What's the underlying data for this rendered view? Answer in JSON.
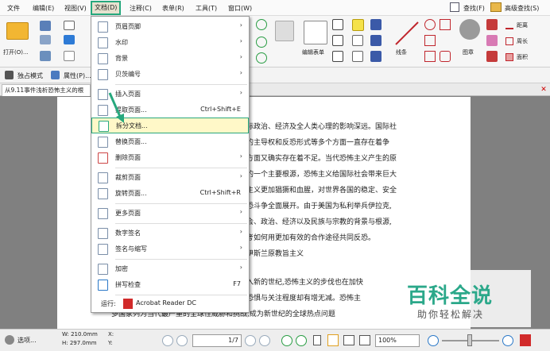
{
  "menubar": {
    "items": [
      "文件",
      "编辑(E)",
      "视图(V)",
      "文档(D)",
      "注释(C)",
      "表单(R)",
      "工具(T)",
      "窗口(W)"
    ],
    "right": [
      "查找(F)",
      "高级查找(S)"
    ]
  },
  "ribbon": {
    "open_label": "打开(O)...",
    "edit_form_label": "编辑表单",
    "lines_label": "线条",
    "stamp_label": "图章",
    "distance_label": "距离",
    "perimeter_label": "周长",
    "area_label": "面积"
  },
  "row2": {
    "solo_mode": "独占模式",
    "properties": "属性(P)..."
  },
  "doc_tab": "从9.11事件浅析恐怖主义的根",
  "dropdown": {
    "items": [
      {
        "label": "页眉页脚",
        "arrow": true
      },
      {
        "label": "水印",
        "arrow": true
      },
      {
        "label": "背景",
        "arrow": true
      },
      {
        "label": "贝茨编号",
        "arrow": true
      },
      {
        "label": "插入页面",
        "arrow": true
      },
      {
        "label": "提取页面...",
        "shortcut": "Ctrl+Shift+E"
      },
      {
        "label": "拆分文档...",
        "highlighted": true
      },
      {
        "label": "替换页面..."
      },
      {
        "label": "删除页面",
        "arrow": true
      },
      {
        "label": "裁剪页面",
        "arrow": true
      },
      {
        "label": "旋转页面...",
        "shortcut": "Ctrl+Shift+R"
      },
      {
        "label": "更多页面",
        "arrow": true
      },
      {
        "label": "数字签名",
        "arrow": true
      },
      {
        "label": "签名与缩写",
        "arrow": true
      },
      {
        "label": "加密",
        "arrow": true
      },
      {
        "label": "拼写检查",
        "shortcut": "F7"
      }
    ],
    "run_label": "运行:",
    "run_app": "Acrobat Reader DC"
  },
  "document": {
    "lines": [
      "际政治、经济及全人类心理的影响深远。国际社",
      "的主导权和反恐形式等多个方面一直存在着争",
      "方面又确实存在着不足。当代恐怖主义产生的原",
      "的一个主要根源，恐怖主义给国际社会带来巨大",
      "主义更加猖獗和血腥，对世界各国的稳定、安全",
      "恐斗争全面展开。由于美国为私利举兵伊拉克,",
      "会、政治、经济以及民族与宗教的背景与根源,",
      "考如何用更加有效的合作途径共同反恐。",
      "伊斯兰原教旨主义",
      "入新的世纪,恐怖主义的步伐也在加快",
      "恐惧与关注程度却有增无减。恐怖主",
      "多国家列为当代最严重的全球性威胁和挑战,成为新世纪的全球热点问题"
    ]
  },
  "status": {
    "select_label": "选项...",
    "width": "W: 210.0mm",
    "height": "H: 297.0mm",
    "x": "X:",
    "y": "Y:",
    "page": "1/7",
    "zoom": "100%"
  },
  "watermark": {
    "title": "百科全说",
    "subtitle": "助你轻松解决"
  }
}
